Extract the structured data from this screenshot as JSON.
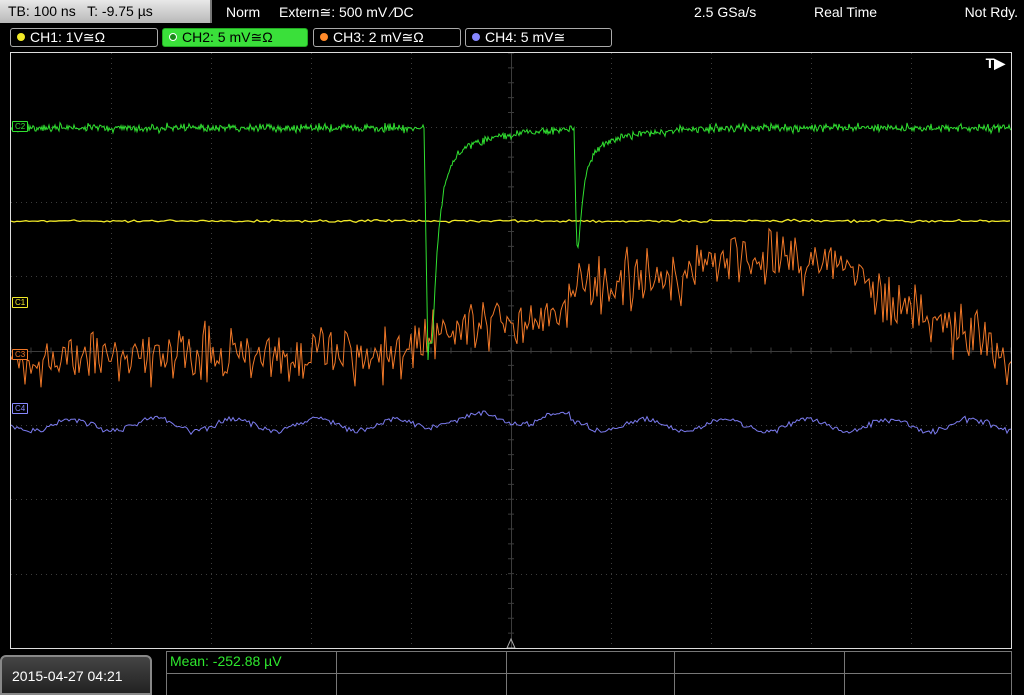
{
  "status_bar": {
    "timebase": "TB: 100 ns",
    "trigger_time": "T: -9.75 µs",
    "mode": "Norm",
    "trigger_source": "Extern≅: 500 mV ⁄DC",
    "sample_rate": "2.5 GSa/s",
    "acquisition": "Real Time",
    "status": "Not Rdy."
  },
  "channels": [
    {
      "label": "CH1: 1V≅Ω",
      "color": "#f2ea28"
    },
    {
      "label": "CH2: 5 mV≅Ω",
      "color": "#30e030"
    },
    {
      "label": "CH3: 2 mV≅Ω",
      "color": "#ff8a2a"
    },
    {
      "label": "CH4: 5 mV≅",
      "color": "#8888ff"
    }
  ],
  "markers": {
    "c1": "C1",
    "c2": "C2",
    "c3": "C3",
    "c4": "C4",
    "trigger": "T▶"
  },
  "measurement": {
    "mean": "Mean: -252.88 µV"
  },
  "footer": {
    "datetime": "2015-04-27 04:21"
  },
  "colors": {
    "grid": "#3c3c3c",
    "ch1": "#f2ea28",
    "ch2": "#30e030",
    "ch3": "#f07828",
    "ch4": "#7c7cf0"
  }
}
